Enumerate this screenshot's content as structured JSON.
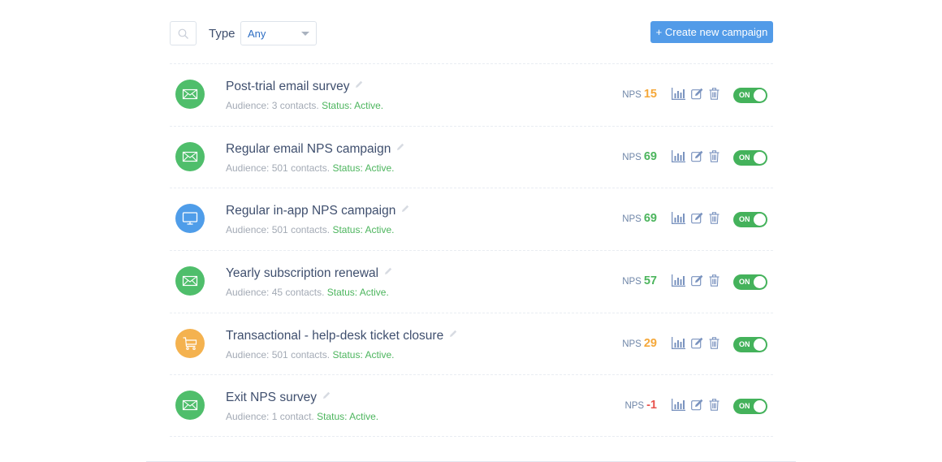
{
  "toolbar": {
    "search_icon": "search-icon",
    "type_label": "Type",
    "type_select_value": "Any",
    "create_button_label": "+ Create new campaign"
  },
  "colors": {
    "primary": "#529be8",
    "email": "#4fbe6b",
    "in_app": "#4f9de9",
    "transactional": "#f4b24f",
    "score_green": "#4cb55d",
    "score_orange": "#f5a83a",
    "score_red": "#e8544e",
    "toggle_on": "#44b25b"
  },
  "campaigns": [
    {
      "name": "Post-trial email survey",
      "icon": "envelope-icon",
      "channel": "email",
      "audience": "Audience: 3 contacts.",
      "status": "Status: Active.",
      "nps_label": "NPS",
      "nps": "15",
      "score_level": "orange",
      "toggle": "ON"
    },
    {
      "name": "Regular email NPS campaign",
      "icon": "envelope-icon",
      "channel": "email",
      "audience": "Audience: 501 contacts.",
      "status": "Status: Active.",
      "nps_label": "NPS",
      "nps": "69",
      "score_level": "green",
      "toggle": "ON"
    },
    {
      "name": "Regular in-app NPS campaign",
      "icon": "monitor-icon",
      "channel": "in_app",
      "audience": "Audience: 501 contacts.",
      "status": "Status: Active.",
      "nps_label": "NPS",
      "nps": "69",
      "score_level": "green",
      "toggle": "ON"
    },
    {
      "name": "Yearly subscription renewal",
      "icon": "envelope-icon",
      "channel": "email",
      "audience": "Audience: 45 contacts.",
      "status": "Status: Active.",
      "nps_label": "NPS",
      "nps": "57",
      "score_level": "green",
      "toggle": "ON"
    },
    {
      "name": "Transactional - help-desk ticket closure",
      "icon": "cart-icon",
      "channel": "transactional",
      "audience": "Audience: 501 contacts.",
      "status": "Status: Active.",
      "nps_label": "NPS",
      "nps": "29",
      "score_level": "orange",
      "toggle": "ON"
    },
    {
      "name": "Exit NPS survey",
      "icon": "envelope-icon",
      "channel": "email",
      "audience": "Audience: 1 contact.",
      "status": "Status: Active.",
      "nps_label": "NPS",
      "nps": "-1",
      "score_level": "red",
      "toggle": "ON"
    }
  ]
}
